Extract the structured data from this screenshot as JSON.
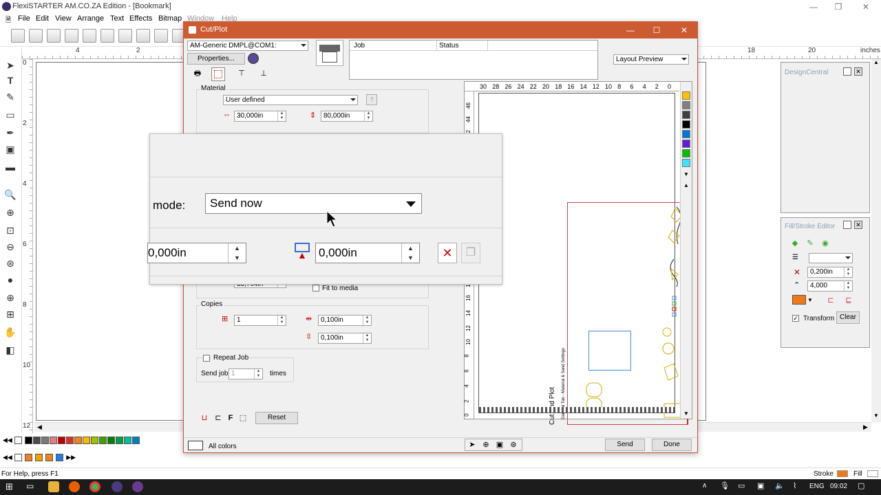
{
  "app": {
    "title": "FlexiSTARTER AM.CO.ZA Edition - [Bookmark]",
    "menus": [
      "File",
      "Edit",
      "View",
      "Arrange",
      "Text",
      "Effects",
      "Bitmap",
      "Window",
      "Help"
    ],
    "ruler_top_labels": [
      "4",
      "2",
      "18",
      "20",
      "inches"
    ],
    "ruler_left_labels": [
      "0",
      "2",
      "4",
      "6",
      "8",
      "10",
      "12"
    ],
    "status": "For Help, press F1",
    "stroke_label": "Stroke",
    "fill_label": "Fill",
    "stroke_color": "#f07818",
    "palette_colors": [
      "#000000",
      "#4a4a4a",
      "#7a7a7a",
      "#e08080",
      "#c00000",
      "#e03020",
      "#f08020",
      "#f0c000",
      "#a0c000",
      "#40a000",
      "#008000",
      "#00a040",
      "#00c0a0",
      "#0080c0"
    ]
  },
  "design_central": {
    "title": "DesignCentral"
  },
  "fill_stroke": {
    "title": "Fill/Stroke Editor",
    "width_value": "0,200in",
    "miter_value": "4,000",
    "transform_label": "Transform",
    "transform_checked": true,
    "clear_label": "Clear",
    "swatch_color": "#f07818"
  },
  "dialog": {
    "title": "Cut/Plot",
    "device": "AM-Generic DMPL@COM1:",
    "properties_label": "Properties...",
    "job_columns": [
      "Job",
      "Status"
    ],
    "preview_mode": "Layout Preview",
    "material": {
      "legend": "Material",
      "type": "User defined",
      "width": "30,000in",
      "length": "80,000in"
    },
    "hidden_field": "33,704in",
    "fit_to_media_label": "Fit to media",
    "copies": {
      "legend": "Copies",
      "count": "1",
      "spacing_x": "0,100in",
      "spacing_y": "0,100in"
    },
    "repeat_job_label": "Repeat Job",
    "send_job_label": "Send job",
    "send_job_count": "1",
    "times_label": "times",
    "reset_label": "Reset",
    "all_colors_label": "All colors",
    "send_label": "Send",
    "done_label": "Done",
    "preview_ruler_top": [
      "30",
      "28",
      "26",
      "24",
      "22",
      "20",
      "18",
      "16",
      "14",
      "12",
      "10",
      "8",
      "6",
      "4",
      "2",
      "0"
    ],
    "preview_ruler_left": [
      "46",
      "44",
      "42",
      "18",
      "16",
      "14",
      "12",
      "10",
      "8",
      "6",
      "4",
      "2",
      "0"
    ],
    "preview_text_1": "Cut and Plot",
    "preview_text_2": "General Tab - Material & Send Settings",
    "preview_colors": [
      "#ffc000",
      "#808080",
      "#404040",
      "#000000",
      "#0078d4",
      "#6020d0",
      "#00c000",
      "#40e0ff"
    ]
  },
  "zoom_overlay": {
    "mode_label": "mode:",
    "mode_value": "Send now",
    "offset_x": "0,000in",
    "offset_y": "0,000in"
  },
  "taskbar": {
    "lang": "ENG",
    "time": "09:02"
  }
}
